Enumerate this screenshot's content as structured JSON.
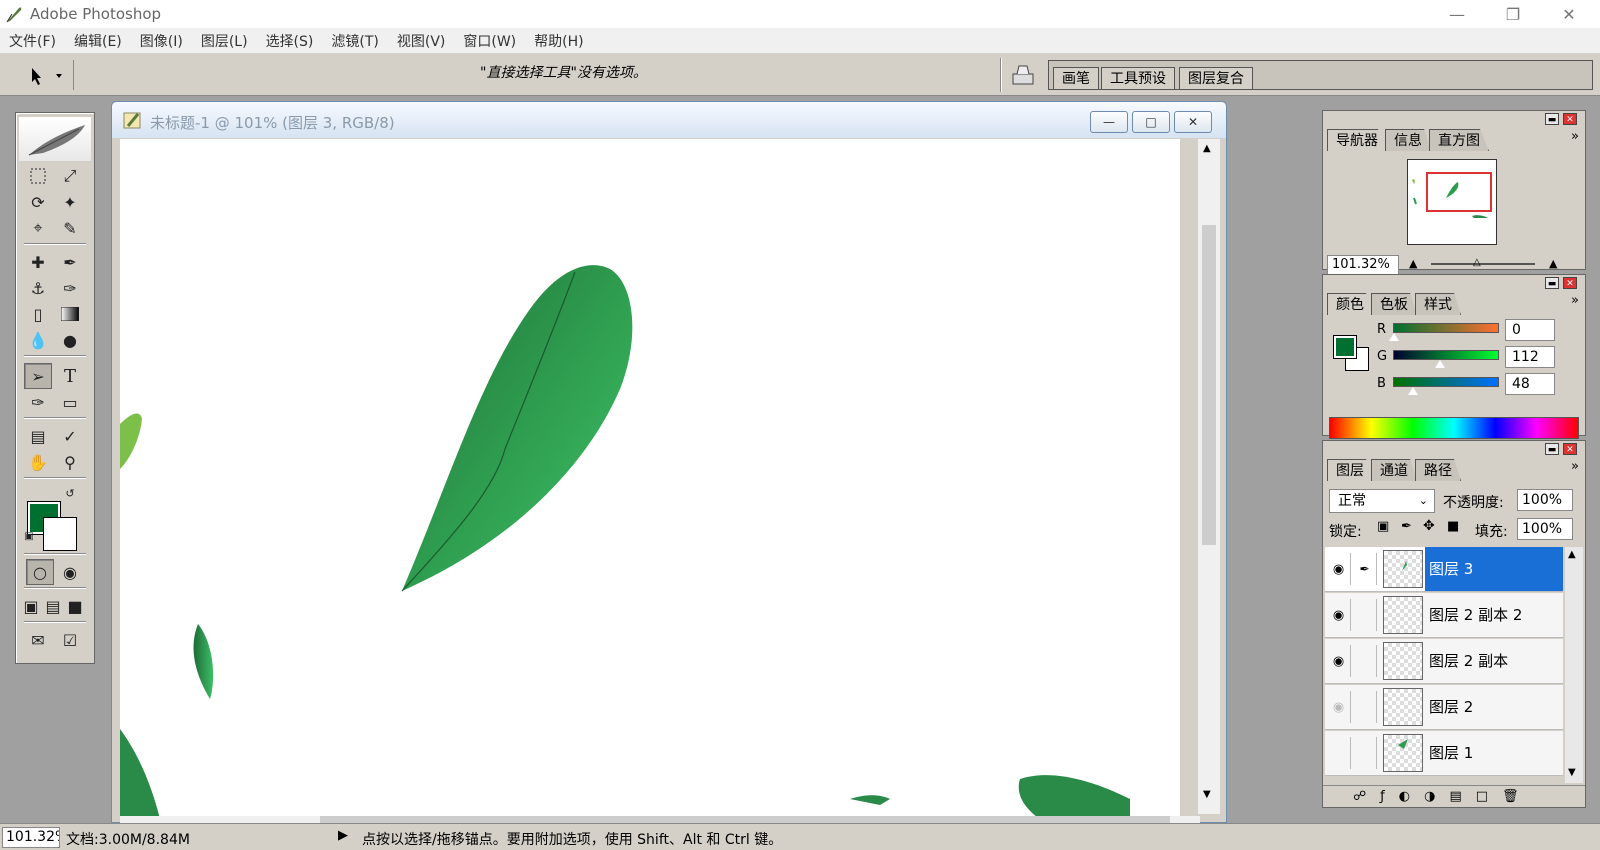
{
  "app": {
    "title": "Adobe Photoshop"
  },
  "menu": [
    "文件(F)",
    "编辑(E)",
    "图像(I)",
    "图层(L)",
    "选择(S)",
    "滤镜(T)",
    "视图(V)",
    "窗口(W)",
    "帮助(H)"
  ],
  "options": {
    "message": "\"直接选择工具\"没有选项。",
    "palette_well_tabs": [
      "画笔",
      "工具预设",
      "图层复合"
    ]
  },
  "document": {
    "title": "未标题-1 @ 101% (图层 3, RGB/8)"
  },
  "navigator": {
    "tabs": [
      "导航器",
      "信息",
      "直方图"
    ],
    "zoom": "101.32%"
  },
  "color": {
    "tabs": [
      "颜色",
      "色板",
      "样式"
    ],
    "foreground": "#007030",
    "r_label": "R",
    "g_label": "G",
    "b_label": "B",
    "r": "0",
    "g": "112",
    "b": "48"
  },
  "layers": {
    "tabs": [
      "图层",
      "通道",
      "路径"
    ],
    "blend_mode": "正常",
    "opacity_label": "不透明度:",
    "opacity": "100%",
    "lock_label": "锁定:",
    "fill_label": "填充:",
    "fill": "100%",
    "items": [
      {
        "name": "图层 3"
      },
      {
        "name": "图层 2 副本 2"
      },
      {
        "name": "图层 2 副本"
      },
      {
        "name": "图层 2"
      },
      {
        "name": "图层 1"
      }
    ]
  },
  "status": {
    "zoom": "101.32%",
    "doc": "文档:3.00M/8.84M",
    "hint": "点按以选择/拖移锚点。要用附加选项，使用 Shift、Alt 和 Ctrl 键。"
  },
  "colors": {
    "accent": "#1a6fd6",
    "leaf": "#2fa84f"
  }
}
